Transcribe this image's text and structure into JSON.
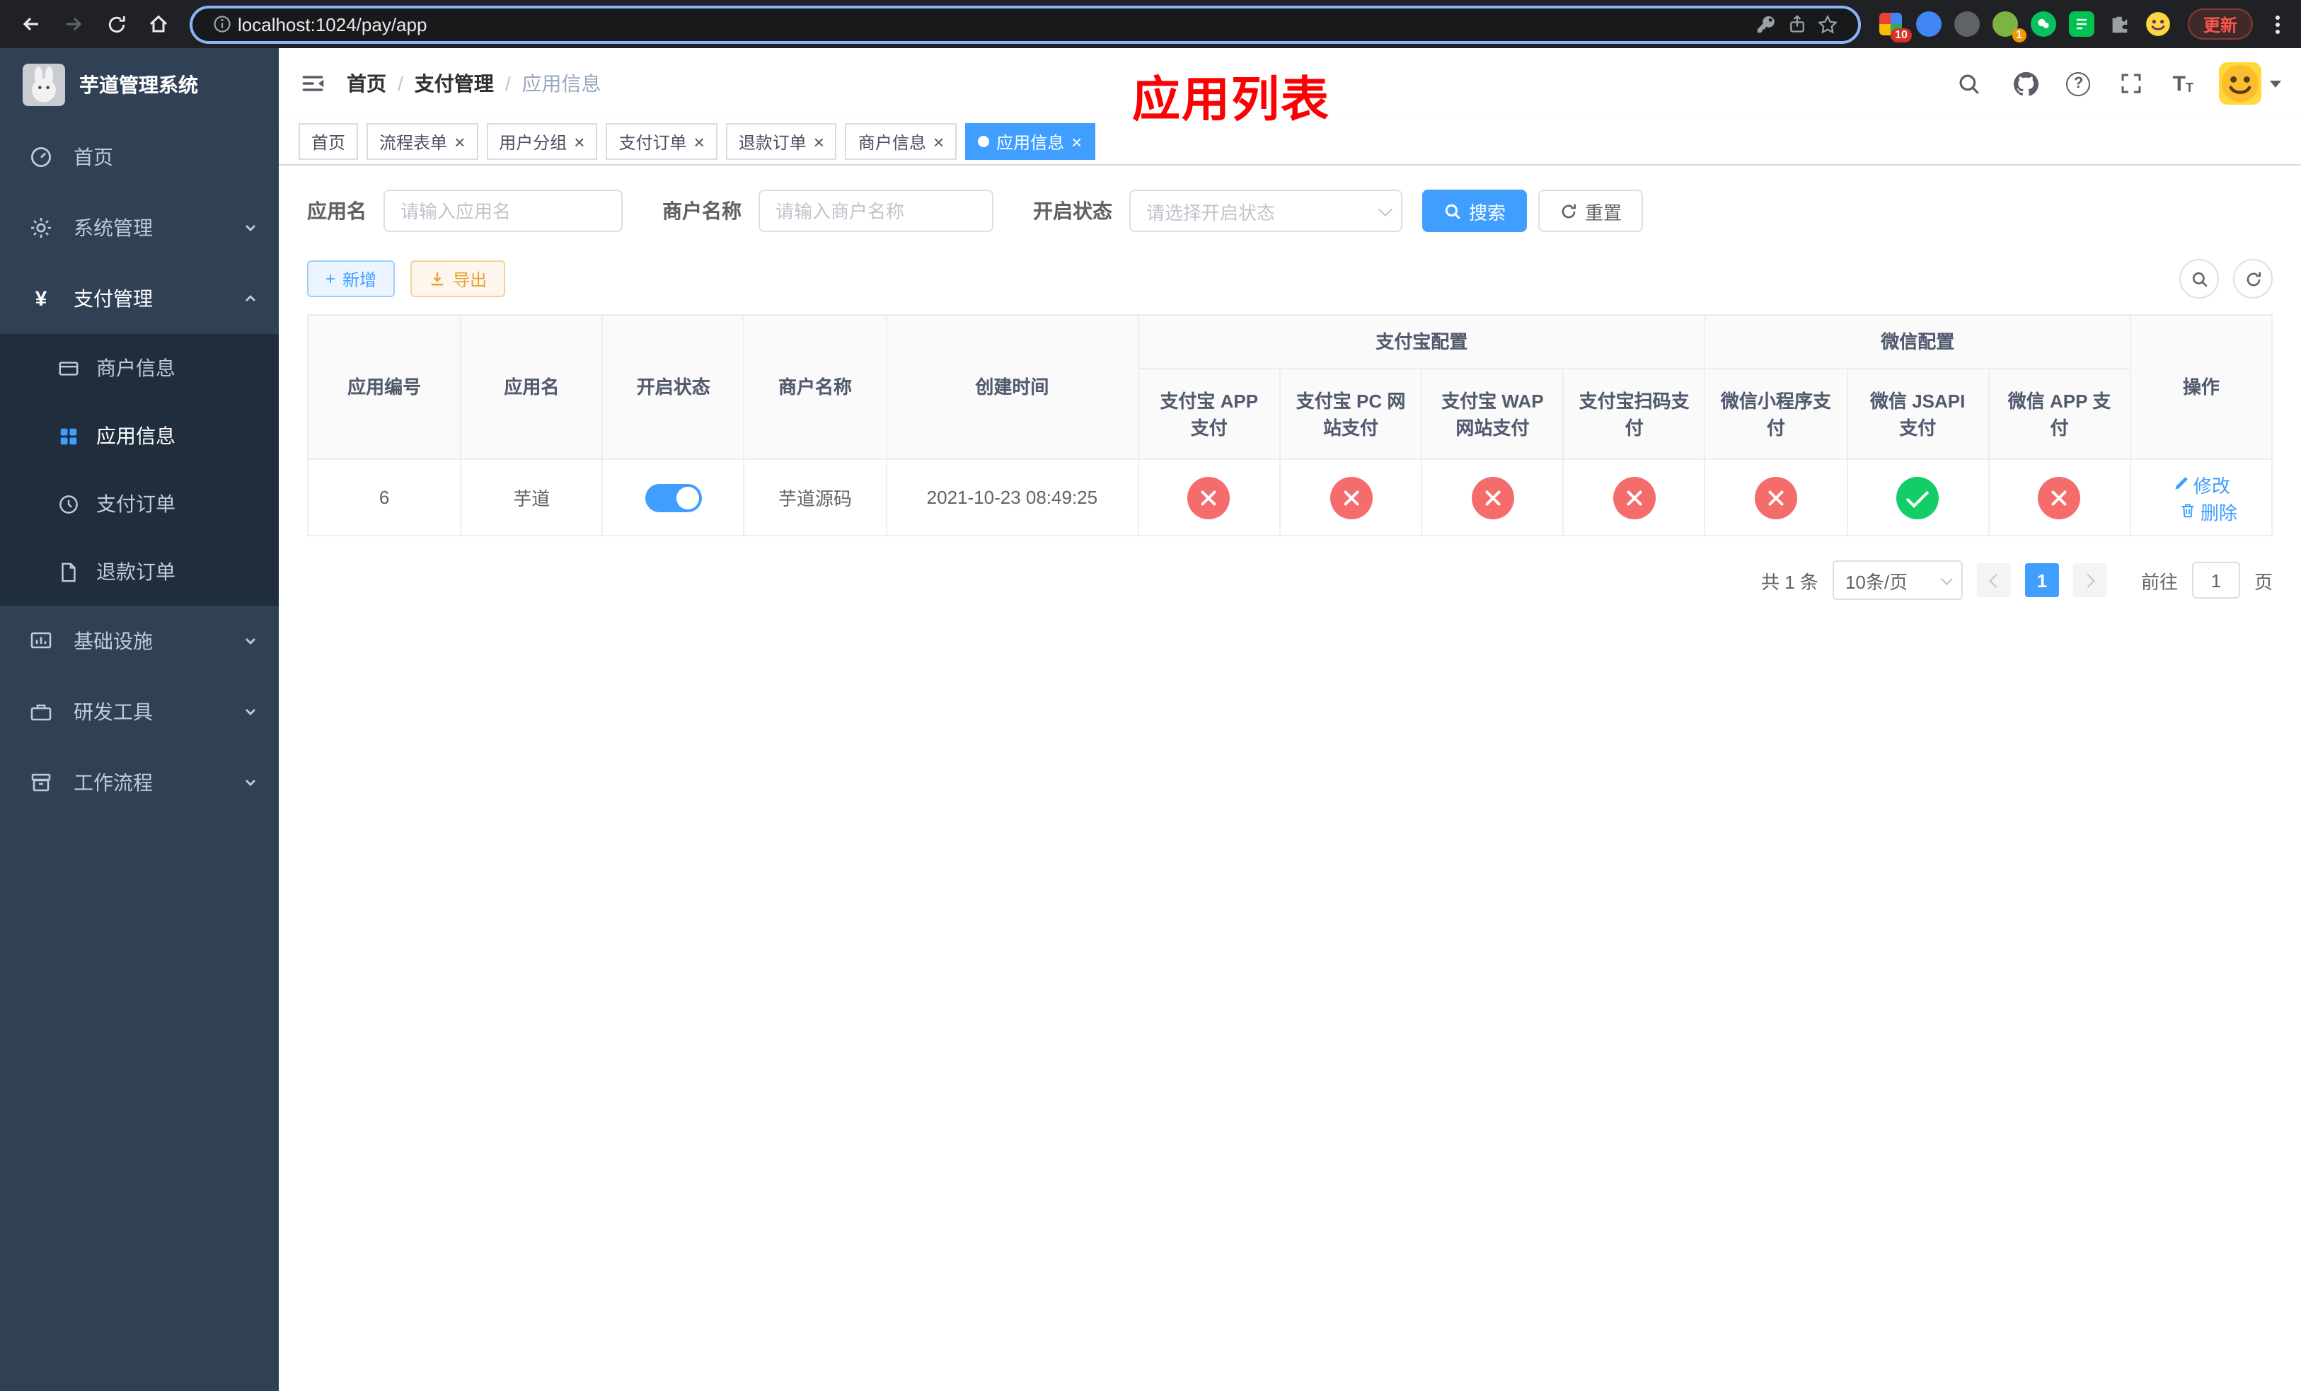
{
  "colors": {
    "accent": "#409eff",
    "sidebar_bg": "#304156",
    "submenu_bg": "#1f2d3d",
    "status_closed": "#f56c6c",
    "status_open": "#13ce66",
    "warning": "#e6a23c",
    "annotation_red": "#fb0103",
    "active_tab": "#409eff"
  },
  "browser": {
    "url": "localhost:1024/pay/app",
    "update_label": "更新",
    "ext_badge_pixel": "10",
    "ext_badge_avatar": "1"
  },
  "sidebar": {
    "title": "芋道管理系统",
    "items": {
      "home": "首页",
      "system": "系统管理",
      "payment": "支付管理",
      "merchant": "商户信息",
      "app_info": "应用信息",
      "pay_order": "支付订单",
      "refund_order": "退款订单",
      "infra": "基础设施",
      "dev_tools": "研发工具",
      "workflow": "工作流程"
    }
  },
  "header": {
    "breadcrumb": [
      "首页",
      "支付管理",
      "应用信息"
    ],
    "overlay_title": "应用列表"
  },
  "tabs": [
    {
      "label": "首页"
    },
    {
      "label": "流程表单"
    },
    {
      "label": "用户分组"
    },
    {
      "label": "支付订单"
    },
    {
      "label": "退款订单"
    },
    {
      "label": "商户信息"
    },
    {
      "label": "应用信息"
    }
  ],
  "filters": {
    "app_name_label": "应用名",
    "app_name_placeholder": "请输入应用名",
    "merchant_label": "商户名称",
    "merchant_placeholder": "请输入商户名称",
    "status_label": "开启状态",
    "status_placeholder": "请选择开启状态",
    "search_label": "搜索",
    "reset_label": "重置"
  },
  "toolbar": {
    "add_label": "新增",
    "export_label": "导出"
  },
  "table": {
    "group_headers": {
      "alipay": "支付宝配置",
      "wechat": "微信配置"
    },
    "columns": [
      "应用编号",
      "应用名",
      "开启状态",
      "商户名称",
      "创建时间",
      "支付宝 APP 支付",
      "支付宝 PC 网站支付",
      "支付宝 WAP 网站支付",
      "支付宝扫码支付",
      "微信小程序支付",
      "微信 JSAPI 支付",
      "微信 APP 支付",
      "操作"
    ],
    "rows": [
      {
        "id": "6",
        "name": "芋道",
        "switch": "on",
        "merchant": "芋道源码",
        "created": "2021-10-23 08:49:25",
        "alipay_app": "closed",
        "alipay_pc": "closed",
        "alipay_wap": "closed",
        "alipay_qr": "closed",
        "wx_mini": "closed",
        "wx_jsapi": "open",
        "wx_app": "closed",
        "edit_label": "修改",
        "delete_label": "删除"
      }
    ]
  },
  "pagination": {
    "total_text": "共 1 条",
    "page_size": "10条/页",
    "current_page": "1",
    "goto_prefix": "前往",
    "goto_value": "1",
    "goto_suffix": "页"
  }
}
